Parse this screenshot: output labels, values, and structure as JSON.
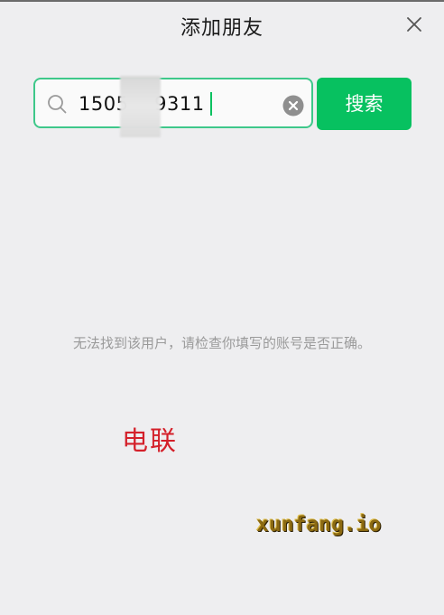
{
  "window": {
    "title": "添加朋友",
    "close_icon": "close-icon"
  },
  "search": {
    "value": "1505    9311",
    "search_icon": "search-icon",
    "clear_icon": "clear-circle-icon",
    "button_label": "搜索"
  },
  "result": {
    "message": "无法找到该用户，请检查你填写的账号是否正确。"
  },
  "watermarks": {
    "cn_text": "电联",
    "site_text": "xunfang.io"
  },
  "colors": {
    "background": "#eeeef0",
    "accent_green": "#07c160",
    "input_border": "#3ec88a",
    "hint_text": "#9a9a9a",
    "watermark_red": "#d4202a",
    "watermark_gold": "#8c6a12"
  }
}
